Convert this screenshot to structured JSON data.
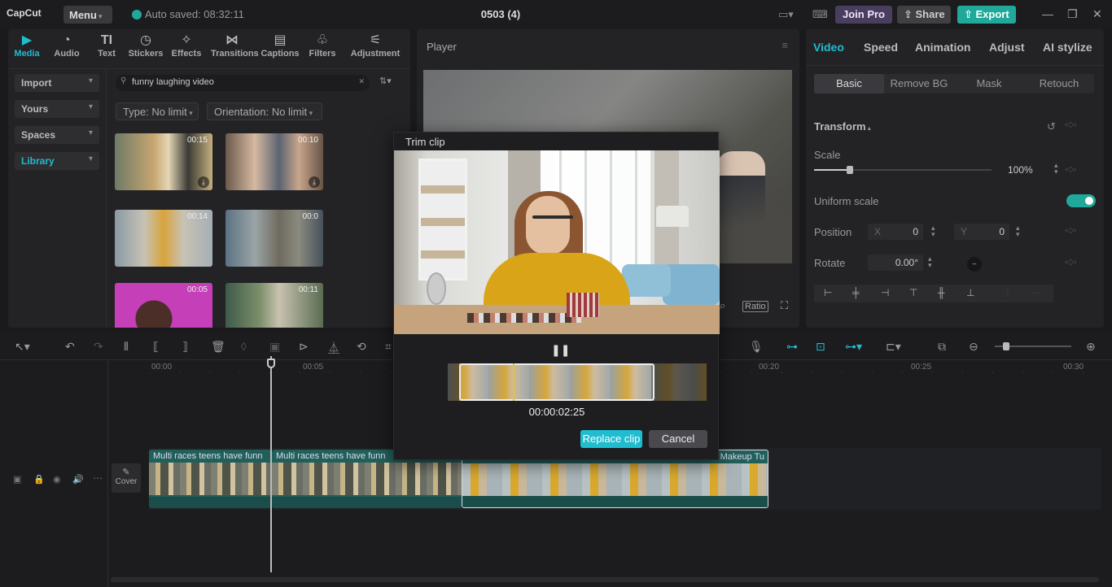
{
  "app": {
    "logo": "CapCut",
    "menu_label": "Menu",
    "autosave": "Auto saved: 08:32:11",
    "project_title": "0503 (4)",
    "join_pro": "Join Pro",
    "share": "Share",
    "export": "Export"
  },
  "toolbar": {
    "tabs": [
      {
        "label": "Media",
        "icon": "media-icon"
      },
      {
        "label": "Audio",
        "icon": "audio-icon"
      },
      {
        "label": "Text",
        "icon": "text-icon"
      },
      {
        "label": "Stickers",
        "icon": "stickers-icon"
      },
      {
        "label": "Effects",
        "icon": "effects-icon"
      },
      {
        "label": "Transitions",
        "icon": "transitions-icon"
      },
      {
        "label": "Captions",
        "icon": "captions-icon"
      },
      {
        "label": "Filters",
        "icon": "filters-icon"
      },
      {
        "label": "Adjustment",
        "icon": "adjustment-icon"
      }
    ]
  },
  "media_sidebar": {
    "items": [
      {
        "label": "Import"
      },
      {
        "label": "Yours"
      },
      {
        "label": "Spaces"
      },
      {
        "label": "Library"
      }
    ]
  },
  "media": {
    "search_value": "funny laughing video",
    "filter_type": "Type: No limit",
    "filter_orientation": "Orientation: No limit",
    "thumbnails": [
      {
        "duration": "00:15"
      },
      {
        "duration": "00:10"
      },
      {
        "duration": "00:14"
      },
      {
        "duration": "00:0"
      },
      {
        "duration": "00:05"
      },
      {
        "duration": "00:11"
      }
    ]
  },
  "player": {
    "label": "Player",
    "ratio": "Ratio"
  },
  "properties": {
    "tabs": [
      "Video",
      "Speed",
      "Animation",
      "Adjust",
      "AI stylize"
    ],
    "sub_tabs": [
      "Basic",
      "Remove BG",
      "Mask",
      "Retouch"
    ],
    "transform_label": "Transform",
    "scale_label": "Scale",
    "scale_value": "100%",
    "scale_fraction": 0.2,
    "uniform_scale_label": "Uniform scale",
    "position_label": "Position",
    "pos_x_label": "X",
    "pos_x_value": "0",
    "pos_y_label": "Y",
    "pos_y_value": "0",
    "rotate_label": "Rotate",
    "rotate_value": "0.00°"
  },
  "timeline": {
    "ruler": [
      "00:00",
      "00:05",
      "00:20",
      "00:25",
      "00:30"
    ],
    "clips": [
      {
        "title": "Multi races teens have funn"
      },
      {
        "title": "Multi races teens have funn"
      },
      {
        "title": "Makeup Tu"
      }
    ],
    "cover_label": "Cover"
  },
  "trim_dialog": {
    "title": "Trim clip",
    "time": "00:00:02:25",
    "replace_label": "Replace clip",
    "cancel_label": "Cancel"
  },
  "colors": {
    "accent": "#20bcd0",
    "export": "#20a89a",
    "clip": "#215f5a"
  }
}
